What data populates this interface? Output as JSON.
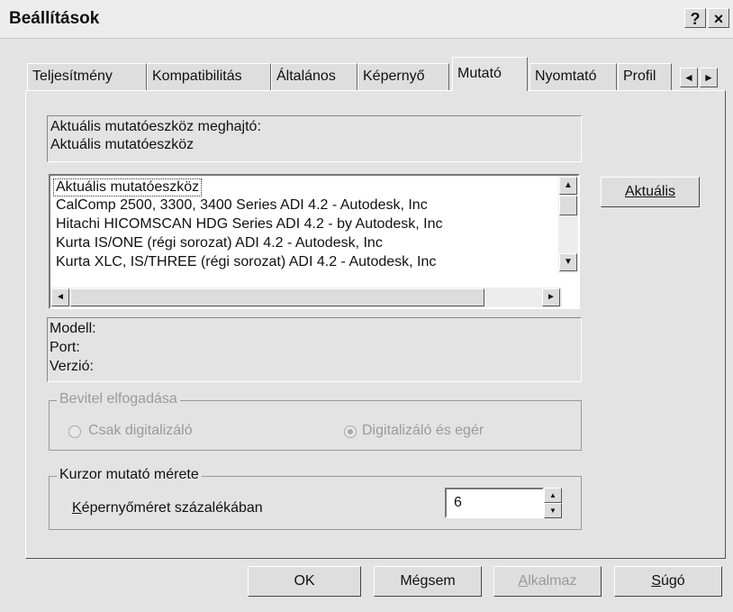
{
  "window": {
    "title": "Beállítások",
    "help_button": "?",
    "close_button": "×"
  },
  "tabs": [
    {
      "label": "Teljesítmény"
    },
    {
      "label": "Kompatibilitás"
    },
    {
      "label": "Általános"
    },
    {
      "label": "Képernyő"
    },
    {
      "label": "Mutató"
    },
    {
      "label": "Nyomtató"
    },
    {
      "label": "Profil"
    }
  ],
  "tab_scroll": {
    "left": "◄",
    "right": "►"
  },
  "driver": {
    "label": "Aktuális mutatóeszköz meghajtó:",
    "value": "Aktuális mutatóeszköz"
  },
  "device_list": {
    "items": [
      "Aktuális mutatóeszköz",
      "CalComp 2500, 3300, 3400 Series ADI 4.2 - Autodesk, Inc",
      "Hitachi HICOMSCAN HDG Series ADI 4.2 - by Autodesk, Inc",
      "Kurta IS/ONE (régi sorozat) ADI 4.2 - Autodesk, Inc",
      "Kurta XLC, IS/THREE (régi sorozat) ADI 4.2 - Autodesk, Inc"
    ],
    "selected_index": 0
  },
  "current_button": "Aktuális",
  "info": {
    "model_label": "Modell:",
    "port_label": "Port:",
    "version_label": "Verzió:"
  },
  "input_accept": {
    "title": "Bevitel elfogadása",
    "option1": "Csak digitalizáló",
    "option2": "Digitalizáló és egér",
    "selected": "option2"
  },
  "cursor_size": {
    "title": "Kurzor mutató mérete",
    "label_accel": "K",
    "label_rest": "épernyőméret százalékában",
    "value": "6"
  },
  "buttons": {
    "ok": "OK",
    "cancel": "Mégsem",
    "apply_accel": "A",
    "apply_rest": "lkalmaz",
    "help_accel": "S",
    "help_rest": "úgó"
  },
  "colors": {
    "face": "#e3e3e3",
    "disabled_text": "#9a9a9a"
  }
}
